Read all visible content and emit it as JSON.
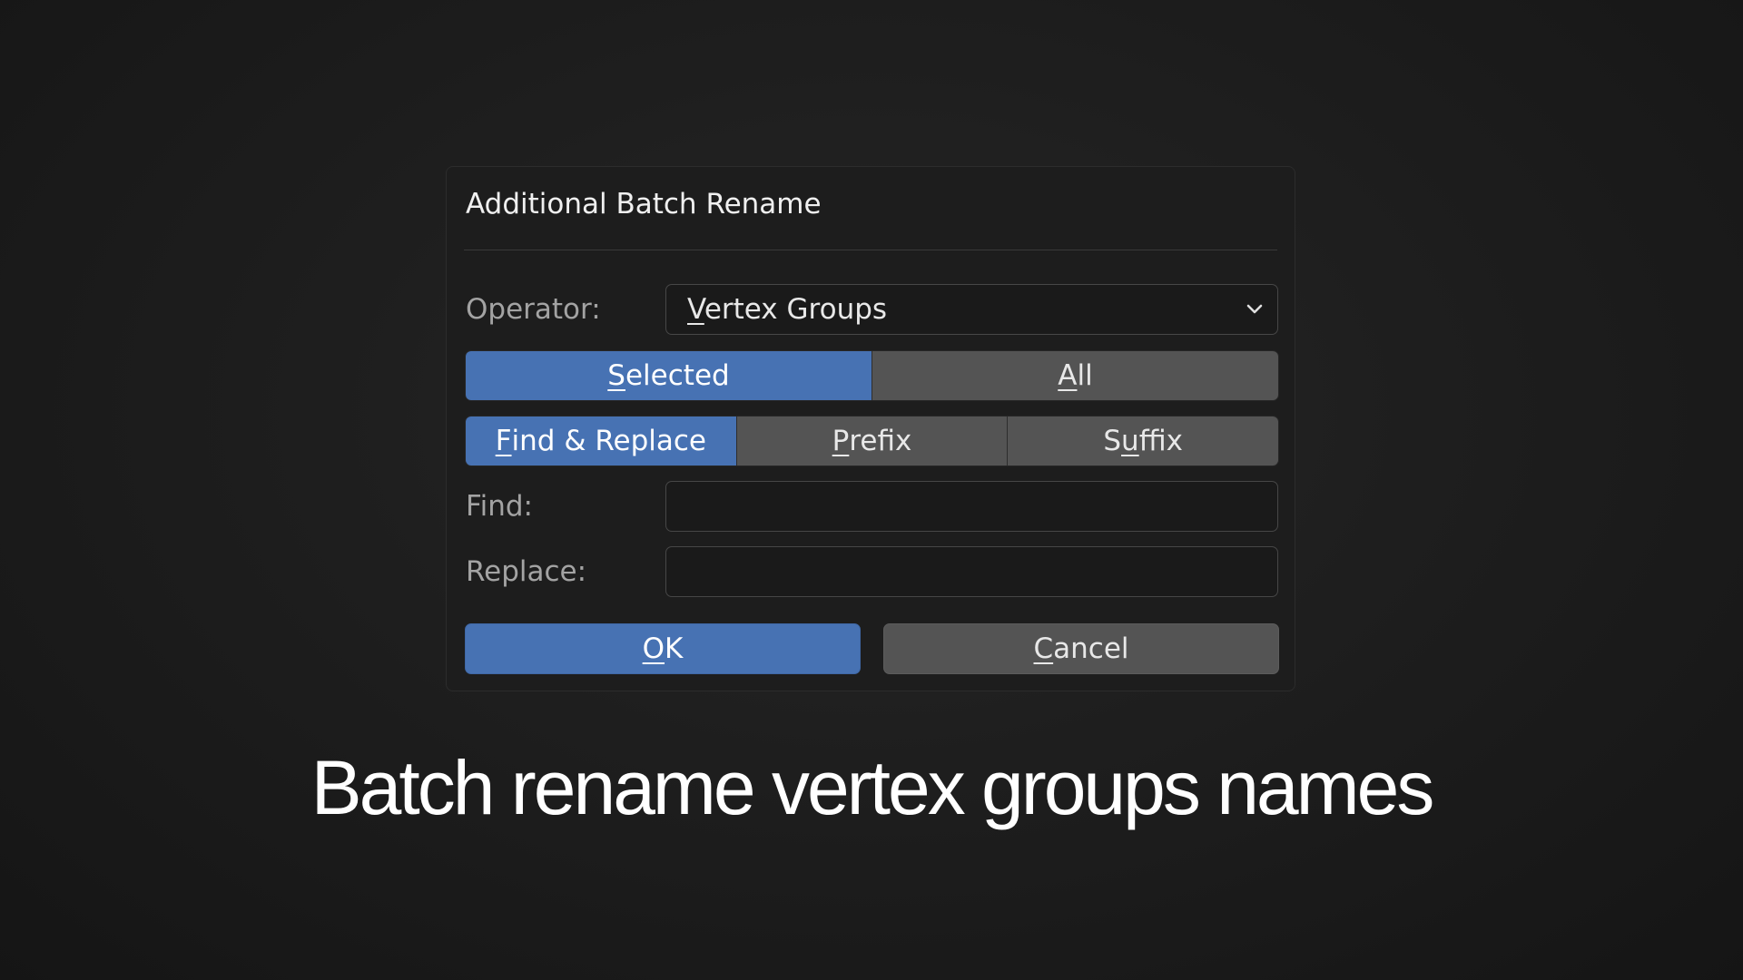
{
  "dialog": {
    "title": "Additional Batch Rename",
    "operator": {
      "label": "Operator:",
      "value_first": "V",
      "value_rest": "ertex Groups"
    },
    "scope": {
      "options": [
        {
          "first": "S",
          "rest": "elected",
          "active": true
        },
        {
          "first": "A",
          "rest": "ll",
          "active": false
        }
      ]
    },
    "mode": {
      "options": [
        {
          "first": "F",
          "rest": "ind & Replace",
          "active": true
        },
        {
          "first": "P",
          "rest": "refix",
          "active": false
        },
        {
          "before": "S",
          "first": "u",
          "rest": "ffix",
          "active": false
        }
      ]
    },
    "find": {
      "label": "Find:",
      "value": ""
    },
    "replace": {
      "label": "Replace:",
      "value": ""
    },
    "buttons": {
      "ok": {
        "first": "O",
        "rest": "K"
      },
      "cancel": {
        "first": "C",
        "rest": "ancel"
      }
    }
  },
  "caption": "Batch rename vertex groups names",
  "colors": {
    "accent": "#4772b3",
    "button": "#545454",
    "field": "#1a1a1a",
    "dialog": "#1d1d1d"
  }
}
